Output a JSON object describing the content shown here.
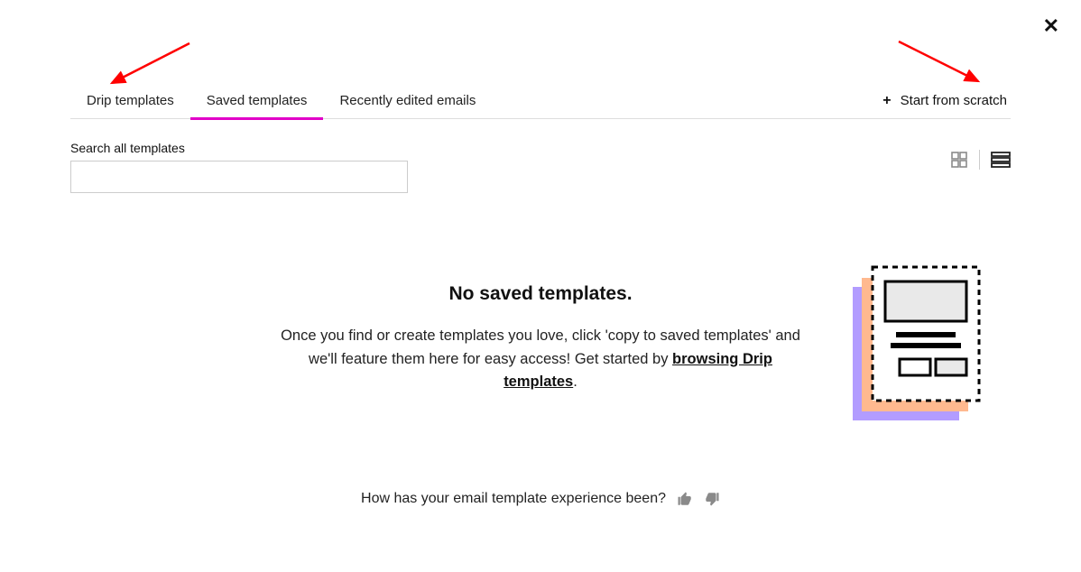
{
  "close_label": "✕",
  "tabs": {
    "drip": "Drip templates",
    "saved": "Saved templates",
    "recent": "Recently edited emails",
    "active": "saved"
  },
  "start_from_scratch": "Start from scratch",
  "search": {
    "label": "Search all templates",
    "value": ""
  },
  "view": {
    "mode": "list"
  },
  "empty_state": {
    "title": "No saved templates.",
    "description_prefix": "Once you find or create templates you love, click 'copy to saved templates' and we'll feature them here for easy access! Get started by ",
    "link_text": "browsing Drip templates",
    "description_suffix": "."
  },
  "feedback": {
    "prompt": "How has your email template experience been?"
  }
}
